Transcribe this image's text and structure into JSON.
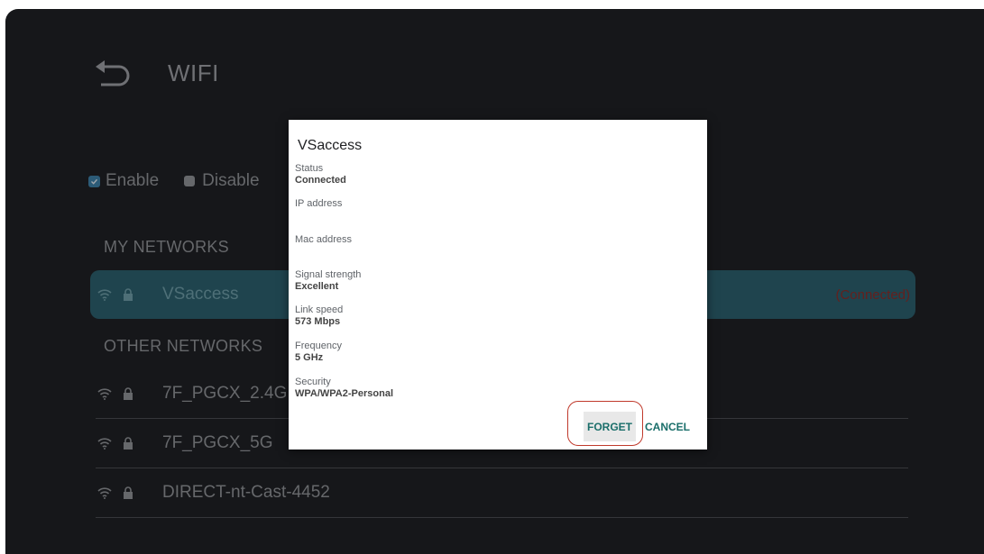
{
  "header": {
    "title": "WIFI"
  },
  "mode": {
    "enable_label": "Enable",
    "disable_label": "Disable"
  },
  "sections": {
    "my_networks": "MY NETWORKS",
    "other_networks": "OTHER NETWORKS"
  },
  "my_networks": [
    {
      "ssid": "VSaccess",
      "status": "(Connected)"
    }
  ],
  "other_networks": [
    {
      "ssid": "7F_PGCX_2.4G"
    },
    {
      "ssid": "7F_PGCX_5G"
    },
    {
      "ssid": "DIRECT-nt-Cast-4452"
    }
  ],
  "dialog": {
    "title": "VSaccess",
    "fields": [
      {
        "label": "Status",
        "value": "Connected"
      },
      {
        "label": "IP address",
        "value": ""
      },
      {
        "label": "Mac address",
        "value": ""
      },
      {
        "label": "Signal strength",
        "value": "Excellent"
      },
      {
        "label": "Link speed",
        "value": "573 Mbps"
      },
      {
        "label": "Frequency",
        "value": "5 GHz"
      },
      {
        "label": "Security",
        "value": "WPA/WPA2-Personal"
      }
    ],
    "forget_label": "FORGET",
    "cancel_label": "CANCEL"
  },
  "colors": {
    "background": "#1f2024",
    "selected_row": "#2b5f6c",
    "connected_status": "#8a2d2a",
    "button_text": "#1a6e6a",
    "highlight_outline": "#c0392b"
  }
}
